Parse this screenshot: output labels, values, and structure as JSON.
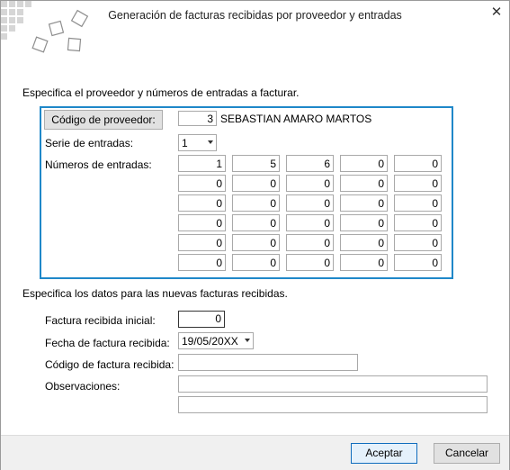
{
  "window": {
    "title": "Generación de facturas recibidas por proveedor y entradas",
    "close_glyph": "✕"
  },
  "section1": {
    "heading": "Especifica el proveedor y números de entradas a facturar.",
    "provider_button": "Código de proveedor:",
    "provider_code": "3",
    "provider_name": "SEBASTIAN AMARO MARTOS",
    "series_label": "Serie de entradas:",
    "series_value": "1",
    "numbers_label": "Números de entradas:",
    "numbers": [
      [
        "1",
        "5",
        "6",
        "0",
        "0"
      ],
      [
        "0",
        "0",
        "0",
        "0",
        "0"
      ],
      [
        "0",
        "0",
        "0",
        "0",
        "0"
      ],
      [
        "0",
        "0",
        "0",
        "0",
        "0"
      ],
      [
        "0",
        "0",
        "0",
        "0",
        "0"
      ],
      [
        "0",
        "0",
        "0",
        "0",
        "0"
      ]
    ]
  },
  "section2": {
    "heading": "Especifica los datos para las nuevas facturas recibidas.",
    "initial_invoice_label": "Factura recibida inicial:",
    "initial_invoice_value": "0",
    "date_label": "Fecha de factura recibida:",
    "date_value": "19/05/20XX",
    "code_label": "Código de factura recibida:",
    "code_value": "",
    "observations_label": "Observaciones:",
    "observations_line1": "",
    "observations_line2": ""
  },
  "footer": {
    "accept": "Aceptar",
    "cancel": "Cancelar"
  },
  "colors": {
    "accent": "#1f88c9",
    "logo": "#9a9a9a"
  }
}
